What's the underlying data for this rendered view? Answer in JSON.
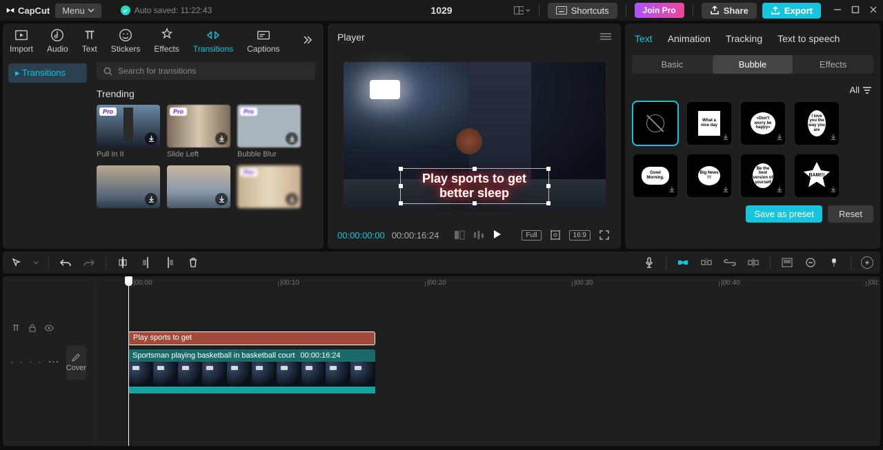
{
  "app": {
    "name": "CapCut",
    "menu": "Menu",
    "auto_saved": "Auto saved: 11:22:43",
    "project_title": "1029"
  },
  "topbar": {
    "shortcuts": "Shortcuts",
    "join_pro": "Join Pro",
    "share": "Share",
    "export": "Export"
  },
  "left_tabs": {
    "import": "Import",
    "audio": "Audio",
    "text": "Text",
    "stickers": "Stickers",
    "effects": "Effects",
    "transitions": "Transitions",
    "captions": "Captions"
  },
  "left": {
    "side_transitions": "Transitions",
    "search_placeholder": "Search for transitions",
    "trending": "Trending",
    "thumbs": [
      {
        "label": "Pull In II",
        "pro": true
      },
      {
        "label": "Slide Left",
        "pro": true
      },
      {
        "label": "Bubble Blur",
        "pro": true
      },
      {
        "label": "",
        "pro": false
      },
      {
        "label": "",
        "pro": false
      },
      {
        "label": "",
        "pro": true
      }
    ]
  },
  "player": {
    "title": "Player",
    "time_current": "00:00:00:00",
    "time_total": "00:00:16:24",
    "full": "Full",
    "ratio": "16:9",
    "overlay_text": "Play sports to get better sleep"
  },
  "right": {
    "tabs": {
      "text": "Text",
      "animation": "Animation",
      "tracking": "Tracking",
      "tts": "Text to speech"
    },
    "subtabs": {
      "basic": "Basic",
      "bubble": "Bubble",
      "effects": "Effects"
    },
    "filter_all": "All",
    "save_preset": "Save as preset",
    "reset": "Reset",
    "bubbles": [
      "none",
      "What a nice day",
      "«Don't worry be happy»",
      "I love you the way you are",
      "Good Morning.",
      "Big News !!!",
      "Be the best version of yourself",
      "BAM!!!"
    ]
  },
  "timeline": {
    "ticks": [
      "00:00",
      "00:10",
      "00:20",
      "00:30",
      "00:40",
      "00:"
    ],
    "text_clip": "Play sports to get",
    "video_clip_name": "Sportsman playing basketball in basketball court",
    "video_clip_dur": "00:00:16:24",
    "cover": "Cover"
  }
}
